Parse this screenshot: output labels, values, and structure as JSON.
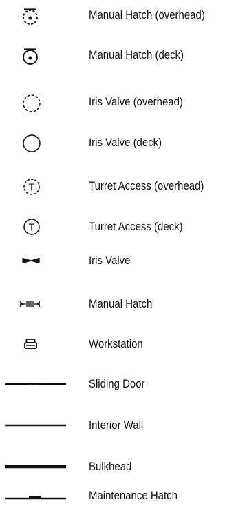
{
  "legend": {
    "items": [
      {
        "symbol": "manual-hatch-overhead-icon",
        "label": "Manual Hatch (overhead)"
      },
      {
        "symbol": "manual-hatch-deck-icon",
        "label": "Manual Hatch (deck)"
      },
      {
        "symbol": "iris-valve-overhead-icon",
        "label": "Iris Valve (overhead)"
      },
      {
        "symbol": "iris-valve-deck-icon",
        "label": "Iris Valve (deck)"
      },
      {
        "symbol": "turret-access-overhead-icon",
        "label": "Turret Access (overhead)"
      },
      {
        "symbol": "turret-access-deck-icon",
        "label": "Turret Access (deck)"
      },
      {
        "symbol": "iris-valve-icon",
        "label": "Iris Valve"
      },
      {
        "symbol": "manual-hatch-icon",
        "label": "Manual Hatch"
      },
      {
        "symbol": "workstation-icon",
        "label": "Workstation"
      },
      {
        "symbol": "sliding-door-icon",
        "label": "Sliding Door"
      },
      {
        "symbol": "interior-wall-icon",
        "label": "Interior Wall"
      },
      {
        "symbol": "bulkhead-icon",
        "label": "Bulkhead"
      },
      {
        "symbol": "maintenance-hatch-icon",
        "label": "Maintenance Hatch"
      }
    ],
    "symbol_letter": "T",
    "colors": {
      "stroke": "#111111",
      "text": "#111111",
      "background": "#ffffff"
    }
  }
}
